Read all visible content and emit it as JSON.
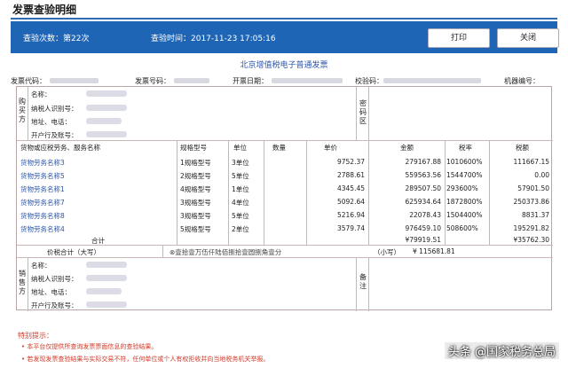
{
  "page": {
    "title": "发票查验明细"
  },
  "query": {
    "count_label": "查验次数：第22次",
    "time_label": "查验时间：2017-11-23 17:05:16"
  },
  "buttons": {
    "print": "打印",
    "close": "关闭"
  },
  "invoice": {
    "title": "北京增值税电子普通发票",
    "meta": {
      "code_label": "发票代码：",
      "number_label": "发票号码：",
      "date_label": "开票日期：",
      "check_label": "校验码：",
      "machine_label": "机器编号："
    },
    "buyer": {
      "side_label": "购买方",
      "name_label": "名称：",
      "taxid_label": "纳税人识别号：",
      "addr_label": "地址、电话：",
      "bank_label": "开户行及账号："
    },
    "cipher_label": "密码区",
    "headers": {
      "item": "货物或应税劳务、服务名称",
      "spec": "规格型号",
      "unit": "单位",
      "qty": "数量",
      "price": "单价",
      "amount": "金额",
      "rate": "税率",
      "tax": "税额"
    },
    "rows": [
      {
        "name": "货物劳务名称3",
        "spec": "1规格型号",
        "unit": "3单位",
        "price": "9752.37",
        "amount": "279167.88",
        "rate": "1010600%",
        "tax": "111667.15"
      },
      {
        "name": "货物劳务名称5",
        "spec": "2规格型号",
        "unit": "5单位",
        "price": "2788.61",
        "amount": "559563.56",
        "rate": "1544700%",
        "tax": "0.00"
      },
      {
        "name": "货物劳务名称1",
        "spec": "4规格型号",
        "unit": "1单位",
        "price": "4345.45",
        "amount": "289507.50",
        "rate": "293600%",
        "tax": "57901.50"
      },
      {
        "name": "货物劳务名称7",
        "spec": "3规格型号",
        "unit": "4单位",
        "price": "5092.64",
        "amount": "625934.64",
        "rate": "1872800%",
        "tax": "250373.86"
      },
      {
        "name": "货物劳务名称8",
        "spec": "3规格型号",
        "unit": "5单位",
        "price": "5216.94",
        "amount": "22078.43",
        "rate": "1504400%",
        "tax": "8831.37"
      },
      {
        "name": "货物劳务名称4",
        "spec": "5规格型号",
        "unit": "2单位",
        "price": "3579.74",
        "amount": "976459.10",
        "rate": "508600%",
        "tax": "195291.82"
      }
    ],
    "total_label": "合计",
    "total_amount": "¥79919.51",
    "total_tax": "¥35762.30",
    "grand_label": "价税合计（大写）",
    "grand_words": "⊗壹拾壹万伍仟陆佰捌拾壹圆捌角壹分",
    "small_label": "（小写）",
    "grand_small": "¥ 115681.81",
    "seller": {
      "side_label": "销售方",
      "name_label": "名称：",
      "taxid_label": "纳税人识别号：",
      "addr_label": "地址、电话：",
      "bank_label": "开户行及账号："
    },
    "remark_label": "备注"
  },
  "notes": {
    "title": "特别提示：",
    "items": [
      "• 本平台仅提供所查询发票票面信息的查验结果。",
      "• 若发现发票查验结果与实际交易不符，任何单位或个人有权拒收并向当地税务机关举报。"
    ]
  },
  "watermark": "头条 @国家税务总局"
}
